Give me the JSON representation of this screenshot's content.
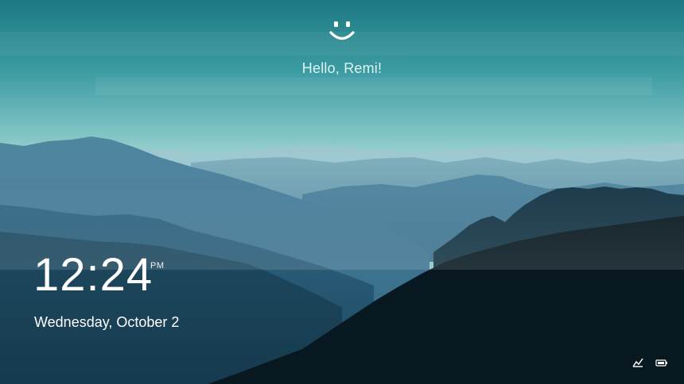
{
  "lockscreen": {
    "greeting": "Hello, Remi!",
    "greeting_icon": "smiley-face-icon",
    "time": "12:24",
    "ampm": "PM",
    "date": "Wednesday, October 2",
    "tray_icons": [
      "network-icon",
      "battery-icon"
    ]
  },
  "colors": {
    "sky_top": "#1f7e86",
    "sky_horizon": "#a9d8d6",
    "mountain_dark": "#0a1f28",
    "text": "#ffffff"
  }
}
